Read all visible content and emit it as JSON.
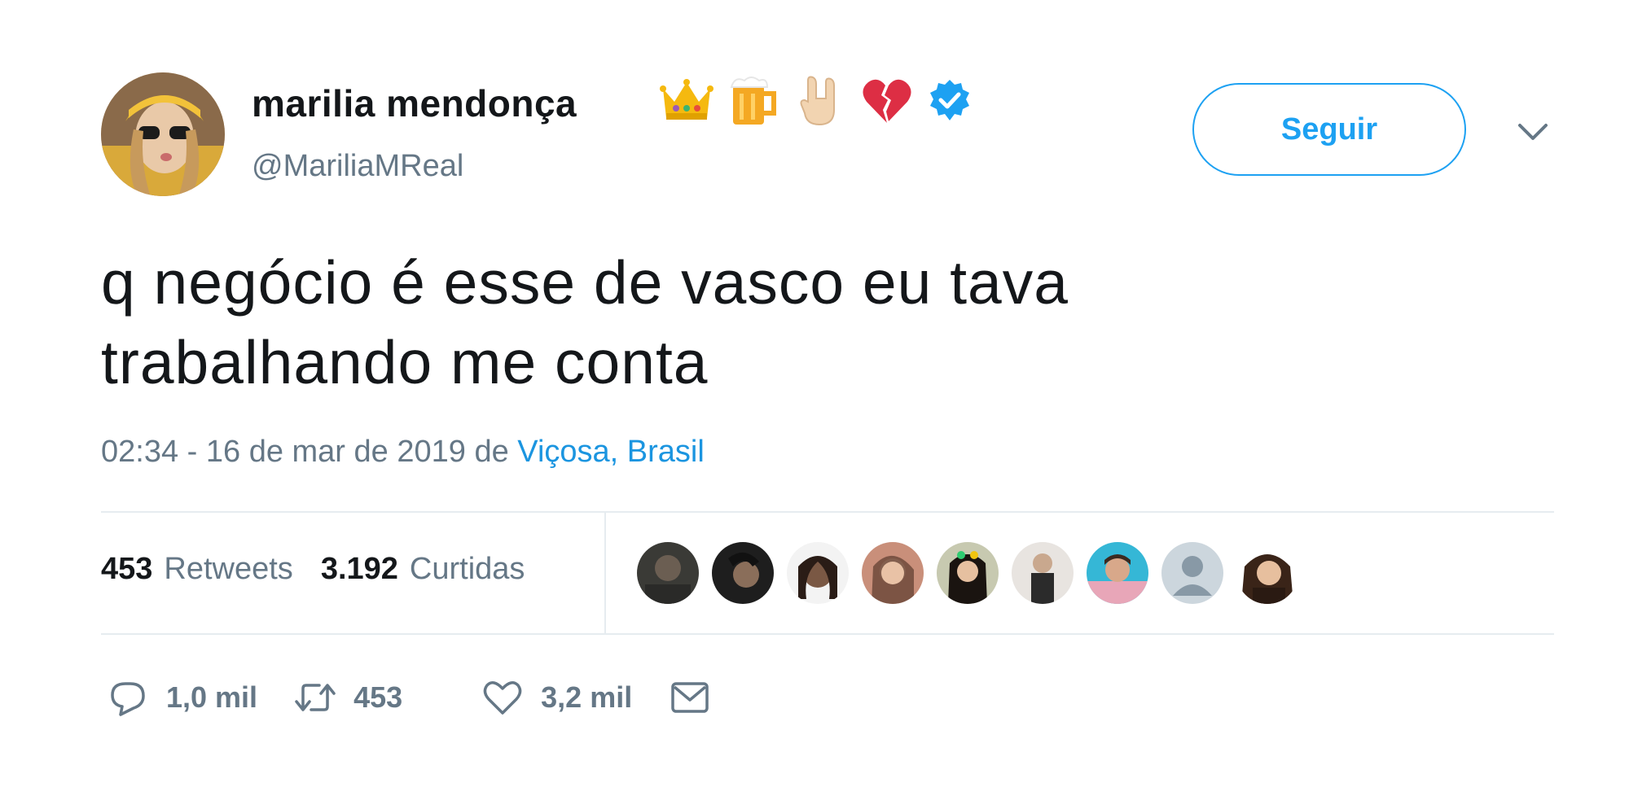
{
  "author": {
    "display_name": "marilia mendonça",
    "handle": "@MariliaMReal",
    "name_emojis": [
      "crown-emoji",
      "beer-mug-emoji",
      "rock-on-hand-emoji",
      "broken-heart-emoji"
    ],
    "verified": true
  },
  "follow_button": {
    "label": "Seguir"
  },
  "tweet": {
    "text_line1": "q negócio é esse de vasco eu tava",
    "text_line2": "trabalhando me conta",
    "timestamp": "02:34 - 16 de mar de 2019",
    "from_word": "de",
    "location": "Viçosa, Brasil"
  },
  "stats": {
    "retweets_count": "453",
    "retweets_label": "Retweets",
    "likes_count": "3.192",
    "likes_label": "Curtidas"
  },
  "likers_count_shown": 9,
  "actions": {
    "reply_count": "1,0 mil",
    "retweet_count": "453",
    "like_count": "3,2 mil"
  },
  "colors": {
    "accent": "#1da1f2",
    "link": "#1b95e0",
    "secondary_text": "#657786",
    "primary_text": "#14171a",
    "divider": "#e6ecf0"
  }
}
